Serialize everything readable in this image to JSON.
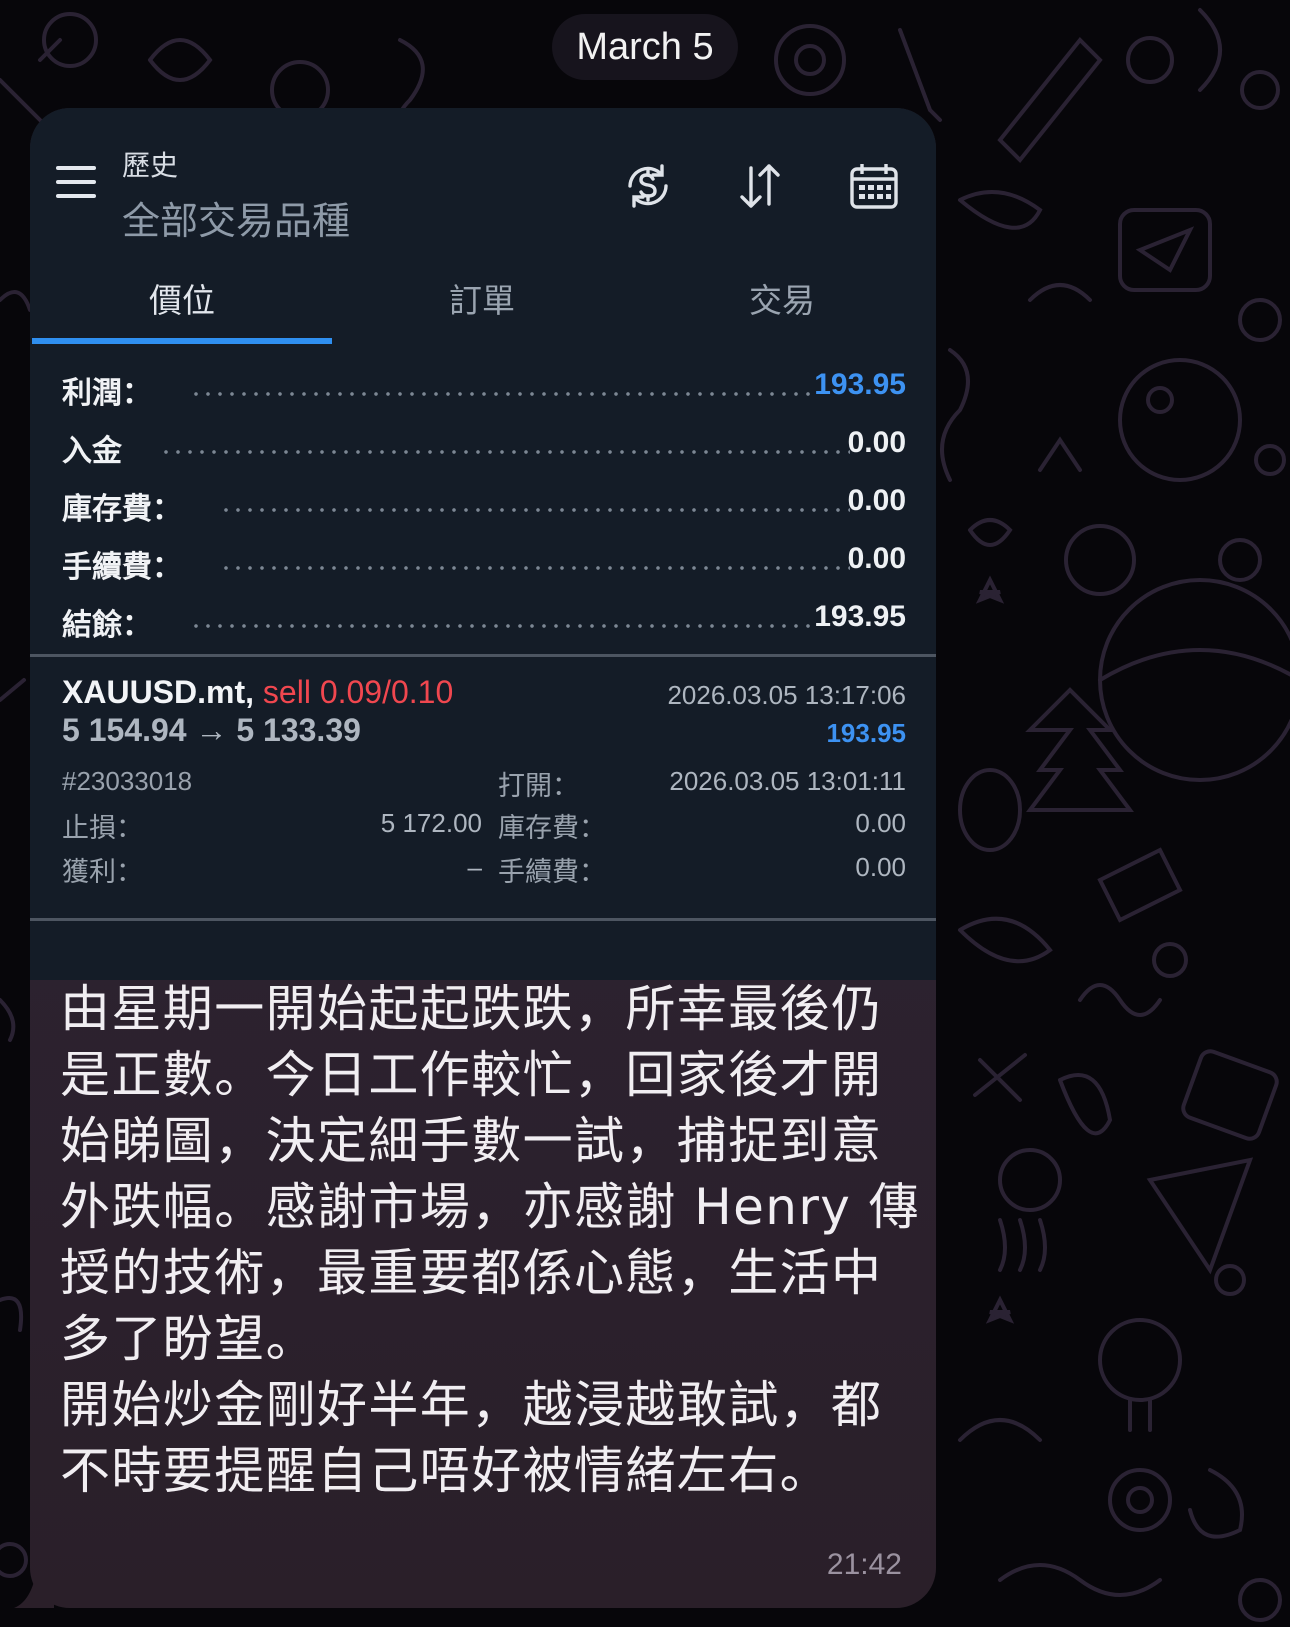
{
  "date_separator": "March 5",
  "app": {
    "title": "歷史",
    "subtitle": "全部交易品種",
    "icons": [
      "hamburger-menu-icon",
      "currency-exchange-icon",
      "sort-arrows-icon",
      "calendar-icon"
    ],
    "tabs": [
      {
        "label": "價位",
        "active": true
      },
      {
        "label": "訂單",
        "active": false
      },
      {
        "label": "交易",
        "active": false
      }
    ],
    "summary": [
      {
        "label": "利潤：",
        "value": "193.95",
        "highlight": true
      },
      {
        "label": "入金",
        "value": "0.00",
        "highlight": false
      },
      {
        "label": "庫存費：",
        "value": "0.00",
        "highlight": false
      },
      {
        "label": "手續費：",
        "value": "0.00",
        "highlight": false
      },
      {
        "label": "結餘：",
        "value": "193.95",
        "highlight": false
      }
    ],
    "order": {
      "symbol": "XAUUSD.mt,",
      "side": "sell 0.09/0.10",
      "close_time": "2026.03.05 13:17:06",
      "prices": "5 154.94 → 5 133.39",
      "profit": "193.95",
      "ticket": "#23033018",
      "open_label": "打開：",
      "open_time": "2026.03.05 13:01:11",
      "sl_label": "止損：",
      "sl_value": "5 172.00",
      "swap_label": "庫存費：",
      "swap_value": "0.00",
      "tp_label": "獲利：",
      "tp_value": "–",
      "commission_label": "手續費：",
      "commission_value": "0.00"
    },
    "colors": {
      "accent_blue": "#3d92f2",
      "sell_red": "#f0474f",
      "app_bg": "#141c27"
    }
  },
  "message": {
    "lines": [
      "由星期一開始起起跌跌，所幸最後仍",
      "是正數。今日工作較忙，回家後才開",
      "始睇圖，決定細手數一試，捕捉到意",
      "外跌幅。感謝市場，亦感謝 Henry 傳",
      "授的技術，最重要都係心態，生活中",
      "多了盼望。",
      "開始炒金剛好半年，越浸越敢試，都",
      "不時要提醒自己唔好被情緒左右。"
    ],
    "time": "21:42"
  }
}
